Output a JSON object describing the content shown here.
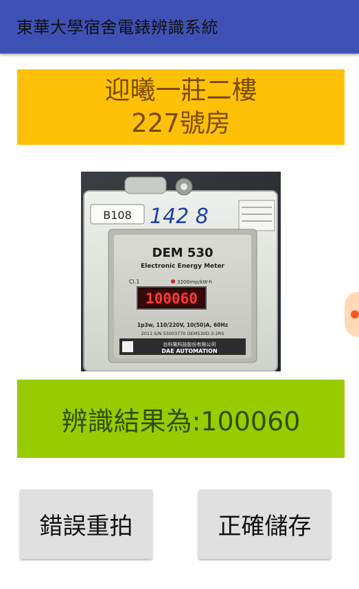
{
  "app": {
    "title": "東華大學宿舍電錶辨識系統"
  },
  "room": {
    "line1": "迎曦一莊二樓",
    "line2": "227號房"
  },
  "meter_photo": {
    "tag": "B108",
    "handwritten": "142  8",
    "model": "DEM 530",
    "subtitle": "Electronic Energy Meter",
    "class": "Cl.1",
    "constant": "3200imp/kW·h",
    "display": "100060",
    "rating": "1p3w, 110/220V, 10(50)A, 60Hz",
    "serial": "2011  S/N  53003770  DEM530D-3-2RS",
    "maker_cn": "台科電科技股份有限公司",
    "maker_en": "DAE AUTOMATION"
  },
  "result": {
    "text": "辨識結果為:100060"
  },
  "buttons": {
    "retake": "錯誤重拍",
    "save": "正確儲存"
  },
  "colors": {
    "appbar": "#3f51b5",
    "room_banner": "#ffc107",
    "result_banner": "#99cc00",
    "button": "#e0e0e0",
    "led": "#ff2b2b"
  }
}
